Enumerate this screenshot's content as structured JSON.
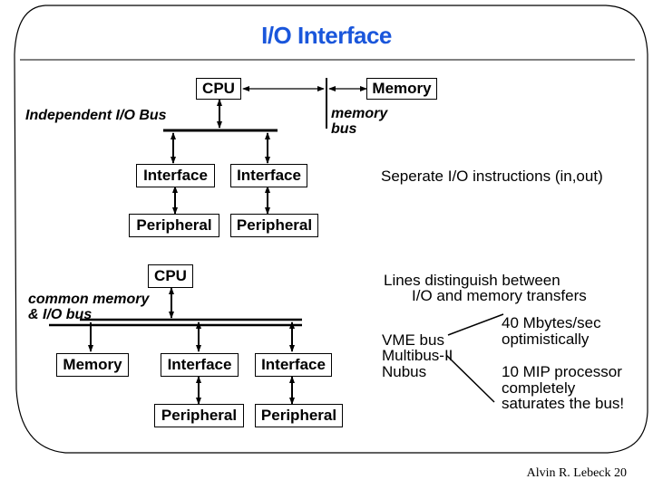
{
  "slide": {
    "title": "I/O Interface",
    "footer": "Alvin R. Lebeck 20",
    "title_color": "#1a56db"
  },
  "independent_io": {
    "bus_label": "Independent I/O Bus",
    "cpu": "CPU",
    "memory": "Memory",
    "memory_bus_label_1": "memory",
    "memory_bus_label_2": "bus",
    "interfaces": [
      "Interface",
      "Interface"
    ],
    "peripherals": [
      "Peripheral",
      "Peripheral"
    ],
    "note": "Seperate I/O instructions (in,out)"
  },
  "common_bus": {
    "bus_label_1": "common memory",
    "bus_label_2": "& I/O bus",
    "cpu": "CPU",
    "memory": "Memory",
    "interfaces": [
      "Interface",
      "Interface"
    ],
    "peripherals": [
      "Peripheral",
      "Peripheral"
    ],
    "note_1": "Lines distinguish between",
    "note_2": "I/O and memory transfers"
  },
  "bus_examples": {
    "buses": [
      "VME bus",
      "Multibus-II",
      "Nubus"
    ],
    "speed_1": "40 Mbytes/sec",
    "speed_2": "optimistically",
    "saturation_1": "10 MIP processor",
    "saturation_2": "completely",
    "saturation_3": "saturates the bus!"
  }
}
